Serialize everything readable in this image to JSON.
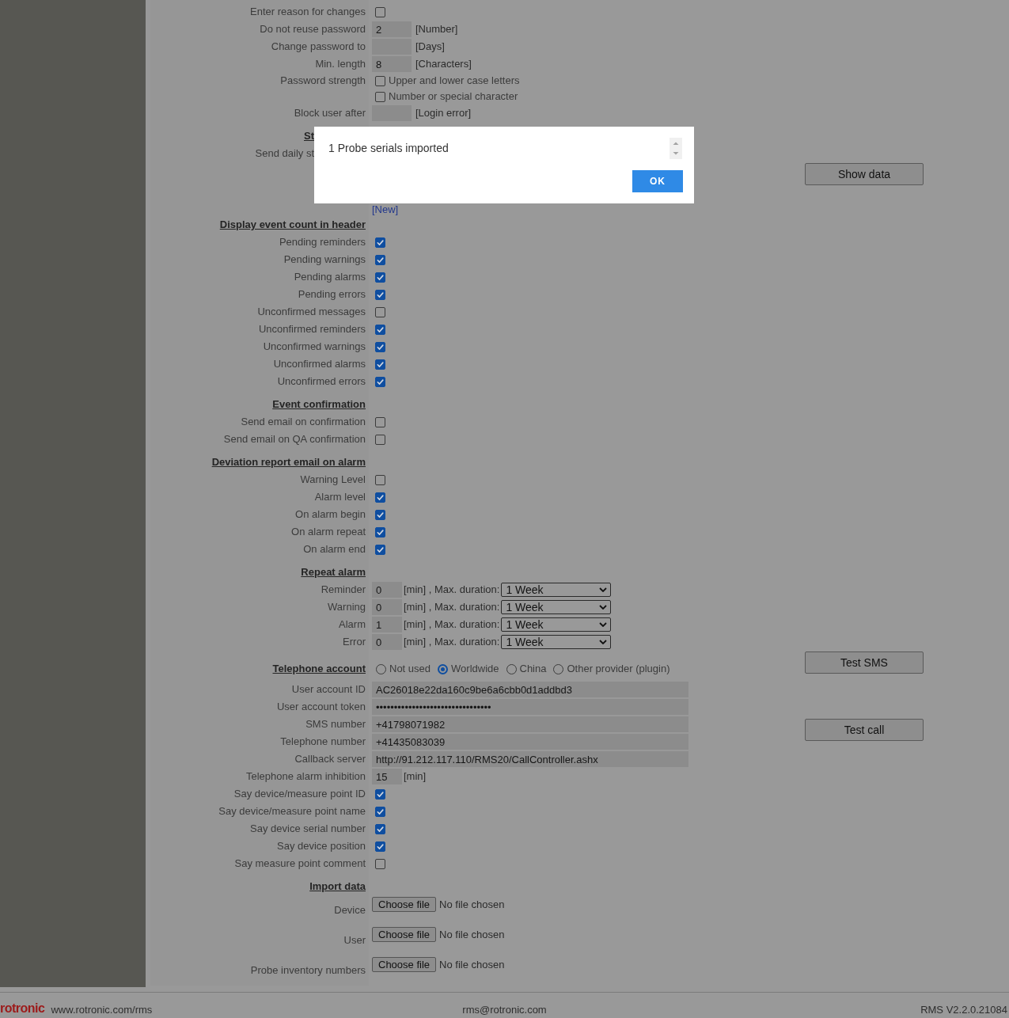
{
  "password_settings": [
    {
      "kind": "checkbox",
      "label": "Enter reason for changes",
      "checked": false
    },
    {
      "kind": "number",
      "label": "Do not reuse password",
      "value": "2",
      "unit": "[Number]"
    },
    {
      "kind": "number",
      "label": "Change password to",
      "unit": "[Days]"
    },
    {
      "kind": "number",
      "label": "Min. length",
      "value": "8",
      "unit": "[Characters]"
    },
    {
      "kind": "checklist",
      "label": "Password strength",
      "options": [
        {
          "label": "Upper and lower case letters",
          "checked": false
        },
        {
          "label": "Number or special character",
          "checked": false
        }
      ]
    },
    {
      "kind": "number",
      "label": "Block user after",
      "unit": "[Login error]"
    }
  ],
  "behind_dialog": {
    "heading": "St",
    "label": "Send daily st",
    "link": "[New]"
  },
  "dialog": {
    "message": "1 Probe serials imported",
    "button": "OK"
  },
  "side_buttons": [
    "Show data",
    "Test SMS",
    "Test call"
  ],
  "sections": [
    {
      "heading": "Display event count in header",
      "rows": [
        {
          "kind": "checkbox",
          "label": "Pending reminders",
          "checked": true
        },
        {
          "kind": "checkbox",
          "label": "Pending warnings",
          "checked": true
        },
        {
          "kind": "checkbox",
          "label": "Pending alarms",
          "checked": true
        },
        {
          "kind": "checkbox",
          "label": "Pending errors",
          "checked": true
        },
        {
          "kind": "checkbox",
          "label": "Unconfirmed messages",
          "checked": false
        },
        {
          "kind": "checkbox",
          "label": "Unconfirmed reminders",
          "checked": true
        },
        {
          "kind": "checkbox",
          "label": "Unconfirmed warnings",
          "checked": true
        },
        {
          "kind": "checkbox",
          "label": "Unconfirmed alarms",
          "checked": true
        },
        {
          "kind": "checkbox",
          "label": "Unconfirmed errors",
          "checked": true
        }
      ]
    },
    {
      "heading": "Event confirmation",
      "rows": [
        {
          "kind": "checkbox",
          "label": "Send email on confirmation",
          "checked": false
        },
        {
          "kind": "checkbox",
          "label": "Send email on QA confirmation",
          "checked": false
        }
      ]
    },
    {
      "heading": "Deviation report email on alarm",
      "rows": [
        {
          "kind": "checkbox",
          "label": "Warning Level",
          "checked": false
        },
        {
          "kind": "checkbox",
          "label": "Alarm level",
          "checked": true
        },
        {
          "kind": "checkbox",
          "label": "On alarm begin",
          "checked": true
        },
        {
          "kind": "checkbox",
          "label": "On alarm repeat",
          "checked": true
        },
        {
          "kind": "checkbox",
          "label": "On alarm end",
          "checked": true
        }
      ]
    },
    {
      "heading": "Repeat alarm",
      "rows": [
        {
          "kind": "repeat",
          "label": "Reminder",
          "value": "0",
          "unit": "[min] , Max. duration:",
          "duration": "1 Week"
        },
        {
          "kind": "repeat",
          "label": "Warning",
          "value": "0",
          "unit": "[min] , Max. duration:",
          "duration": "1 Week"
        },
        {
          "kind": "repeat",
          "label": "Alarm",
          "value": "1",
          "unit": "[min] , Max. duration:",
          "duration": "1 Week"
        },
        {
          "kind": "repeat",
          "label": "Error",
          "value": "0",
          "unit": "[min] , Max. duration:",
          "duration": "1 Week"
        }
      ]
    },
    {
      "heading": "Telephone account",
      "options": [
        {
          "label": "Not used",
          "selected": false
        },
        {
          "label": "Worldwide",
          "selected": true
        },
        {
          "label": "China",
          "selected": false
        },
        {
          "label": "Other provider (plugin)",
          "selected": false
        }
      ],
      "rows": [
        {
          "kind": "text",
          "label": "User account ID",
          "value": "AC26018e22da160c9be6a6cbb0d1addbd3"
        },
        {
          "kind": "text",
          "label": "User account token",
          "value": "••••••••••••••••••••••••••••••••"
        },
        {
          "kind": "text",
          "label": "SMS number",
          "value": "+41798071982"
        },
        {
          "kind": "text",
          "label": "Telephone number",
          "value": "+41435083039"
        },
        {
          "kind": "text",
          "label": "Callback server",
          "value": "http://91.212.117.110/RMS20/CallController.ashx"
        },
        {
          "kind": "minutes",
          "label": "Telephone alarm inhibition",
          "value": "15",
          "unit": "[min]"
        },
        {
          "kind": "checkbox",
          "label": "Say device/measure point ID",
          "checked": true
        },
        {
          "kind": "checkbox",
          "label": "Say device/measure point name",
          "checked": true
        },
        {
          "kind": "checkbox",
          "label": "Say device serial number",
          "checked": true
        },
        {
          "kind": "checkbox",
          "label": "Say device position",
          "checked": true
        },
        {
          "kind": "checkbox",
          "label": "Say measure point comment",
          "checked": false
        }
      ]
    },
    {
      "heading": "Import data",
      "rows": [
        {
          "kind": "file",
          "label": "Device",
          "button": "Choose file",
          "status": "No file chosen"
        },
        {
          "kind": "file",
          "label": "User",
          "button": "Choose file",
          "status": "No file chosen"
        },
        {
          "kind": "file",
          "label": "Probe inventory numbers",
          "button": "Choose file",
          "status": "No file chosen"
        }
      ]
    }
  ],
  "footer": {
    "logo": "rotronic",
    "website": "www.rotronic.com/rms",
    "email": "rms@rotronic.com",
    "version": "RMS V2.2.0.21084"
  }
}
